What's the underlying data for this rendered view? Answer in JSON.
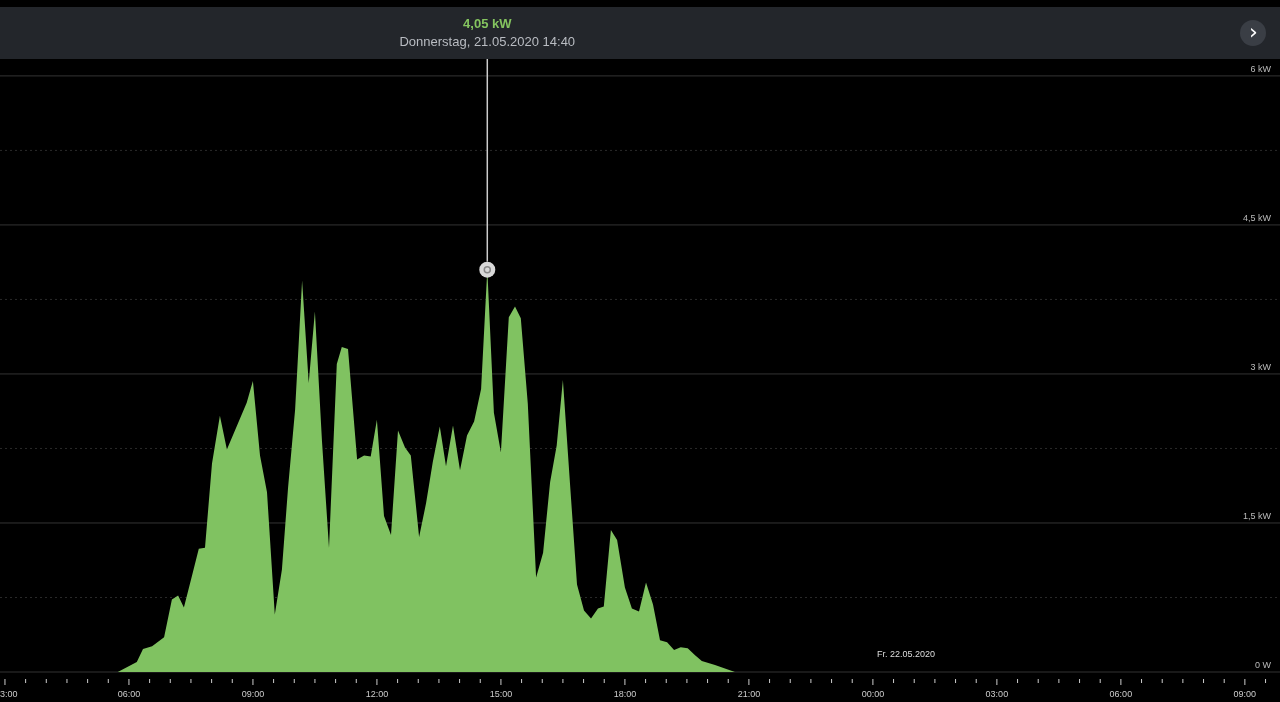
{
  "tooltip": {
    "value": "4,05 kW",
    "datetime": "Donnerstag, 21.05.2020 14:40"
  },
  "next_button": {
    "label": "›"
  },
  "next_day_time_labels": [
    "00:00",
    "03:00",
    "06:00",
    "09:00"
  ],
  "chart_data": {
    "type": "area",
    "grid": true,
    "xlim": [
      2.88,
      33.85
    ],
    "ylim": [
      0,
      6.764
    ],
    "xticks": [
      {
        "value": 3,
        "label": "3:00"
      },
      {
        "value": 6,
        "label": "06:00"
      },
      {
        "value": 9,
        "label": "09:00"
      },
      {
        "value": 12,
        "label": "12:00"
      },
      {
        "value": 15,
        "label": "15:00"
      },
      {
        "value": 18,
        "label": "18:00"
      },
      {
        "value": 21,
        "label": "21:00"
      }
    ],
    "yticks": [
      {
        "value": 0,
        "label": "0 W"
      },
      {
        "value": 1.5,
        "label": "1,5 kW"
      },
      {
        "value": 3,
        "label": "3 kW"
      },
      {
        "value": 4.5,
        "label": "4,5 kW"
      },
      {
        "value": 6,
        "label": "6 kW"
      }
    ],
    "annotations": [
      "Fr. 22.05.2020"
    ],
    "series": [
      {
        "color": "#80c261",
        "x": [
          5.73,
          6.19,
          6.34,
          6.56,
          6.85,
          7.04,
          7.19,
          7.33,
          7.52,
          7.69,
          7.84,
          8.01,
          8.2,
          8.37,
          8.85,
          9.0,
          9.17,
          9.34,
          9.53,
          9.7,
          9.85,
          10.02,
          10.19,
          10.35,
          10.5,
          10.67,
          10.84,
          11.03,
          11.15,
          11.3,
          11.52,
          11.69,
          11.85,
          12.0,
          12.17,
          12.34,
          12.51,
          12.68,
          12.82,
          13.02,
          13.19,
          13.35,
          13.52,
          13.67,
          13.84,
          14.01,
          14.18,
          14.35,
          14.52,
          14.67,
          14.83,
          15.0,
          15.19,
          15.34,
          15.48,
          15.65,
          15.85,
          16.02,
          16.19,
          16.35,
          16.5,
          16.67,
          16.84,
          17.01,
          17.18,
          17.35,
          17.49,
          17.66,
          17.81,
          18.0,
          18.17,
          18.34,
          18.51,
          18.68,
          18.85,
          19.02,
          19.19,
          19.35,
          19.52,
          19.69,
          19.86,
          20.18,
          20.66
        ],
        "values": [
          0,
          0.1,
          0.23,
          0.26,
          0.35,
          0.73,
          0.77,
          0.65,
          0.96,
          1.24,
          1.25,
          2.1,
          2.58,
          2.24,
          2.71,
          2.93,
          2.18,
          1.81,
          0.58,
          1.03,
          1.86,
          2.64,
          3.94,
          2.91,
          3.63,
          2.32,
          1.25,
          3.1,
          3.27,
          3.25,
          2.14,
          2.18,
          2.17,
          2.54,
          1.57,
          1.38,
          2.43,
          2.26,
          2.18,
          1.36,
          1.7,
          2.11,
          2.47,
          2.07,
          2.48,
          2.03,
          2.38,
          2.52,
          2.85,
          4.05,
          2.61,
          2.21,
          3.57,
          3.68,
          3.56,
          2.7,
          0.95,
          1.2,
          1.91,
          2.28,
          2.94,
          1.91,
          0.88,
          0.62,
          0.54,
          0.64,
          0.66,
          1.43,
          1.33,
          0.85,
          0.64,
          0.61,
          0.9,
          0.68,
          0.32,
          0.3,
          0.22,
          0.25,
          0.24,
          0.17,
          0.11,
          0.07,
          0
        ]
      }
    ]
  }
}
